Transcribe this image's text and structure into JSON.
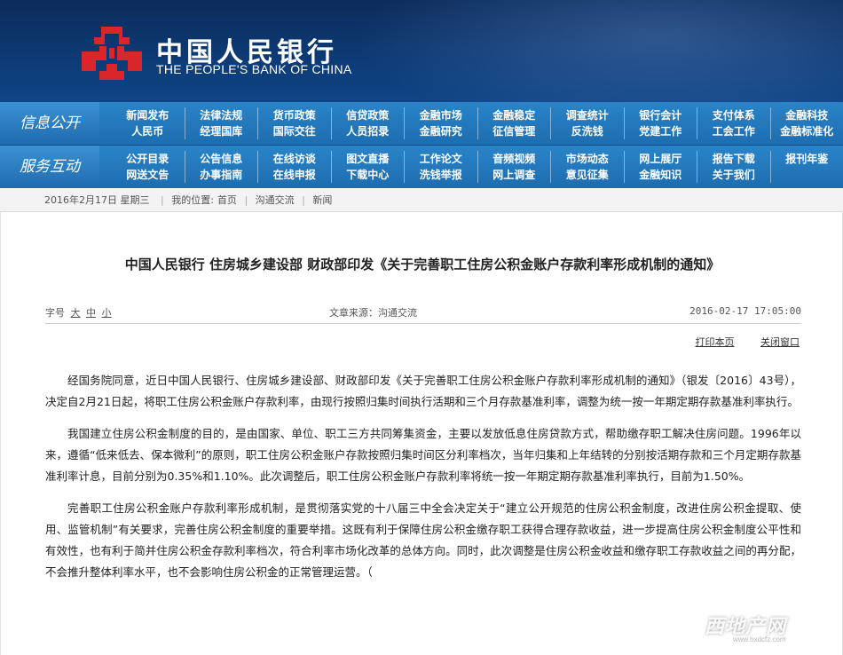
{
  "header": {
    "bank_name_cn": "中国人民银行",
    "bank_name_en": "THE PEOPLE'S BANK OF CHINA",
    "logo_icon": "pboc-logo-icon",
    "colors": {
      "header_bg": "#0d3a74",
      "nav_bg": "#1d6db0",
      "logo_red": "#d8262b"
    }
  },
  "nav": {
    "info_label": "信息公开",
    "info_items": [
      "新闻发布",
      "法律法规",
      "货币政策",
      "信贷政策",
      "金融市场",
      "金融稳定",
      "调查统计",
      "银行会计",
      "支付体系",
      "金融科技",
      "人民币",
      "经理国库",
      "国际交往",
      "人员招录",
      "金融研究",
      "征信管理",
      "反洗钱",
      "党建工作",
      "工会工作",
      "金融标准化"
    ],
    "service_label": "服务互动",
    "service_items": [
      "公开目录",
      "公告信息",
      "在线访谈",
      "图文直播",
      "工作论文",
      "音频视频",
      "市场动态",
      "网上展厅",
      "报告下载",
      "报刊年鉴",
      "网送文告",
      "办事指南",
      "在线申报",
      "下载中心",
      "洗钱举报",
      "网上调查",
      "意见征集",
      "金融知识",
      "关于我们",
      ""
    ]
  },
  "breadcrumb": {
    "date": "2016年2月17日 星期三",
    "location_label": "我的位置:",
    "home": "首页",
    "section": "沟通交流",
    "current": "新闻"
  },
  "article": {
    "title": "中国人民银行 住房城乡建设部 财政部印发《关于完善职工住房公积金账户存款利率形成机制的通知》",
    "fontsize_label": "字号",
    "fontsize_large": "大",
    "fontsize_medium": "中",
    "fontsize_small": "小",
    "source": "文章来源：沟通交流",
    "datetime": "2016-02-17 17:05:00",
    "print_label": "打印本页",
    "close_label": "关闭窗口",
    "paragraphs": [
      "经国务院同意，近日中国人民银行、住房城乡建设部、财政部印发《关于完善职工住房公积金账户存款利率形成机制的通知》（银发〔2016〕43号），决定自2月21日起，将职工住房公积金账户存款利率，由现行按照归集时间执行活期和三个月存款基准利率，调整为统一按一年期定期存款基准利率执行。",
      "我国建立住房公积金制度的目的，是由国家、单位、职工三方共同筹集资金，主要以发放低息住房贷款方式，帮助缴存职工解决住房问题。1996年以来，遵循“低来低去、保本微利”的原则，职工住房公积金账户存款按照归集时间区分利率档次，当年归集和上年结转的分别按活期存款和三个月定期存款基准利率计息，目前分别为0.35%和1.10%。此次调整后，职工住房公积金账户存款利率将统一按一年期定期存款基准利率执行，目前为1.50%。",
      "完善职工住房公积金账户存款利率形成机制，是贯彻落实党的十八届三中全会决定关于“建立公开规范的住房公积金制度，改进住房公积金提取、使用、监管机制”有关要求，完善住房公积金制度的重要举措。这既有利于保障住房公积金缴存职工获得合理存款收益，进一步提高住房公积金制度公平性和有效性，也有利于简并住房公积金存款利率档次，符合利率市场化改革的总体方向。同时，此次调整是住房公积金收益和缴存职工存款收益之间的再分配，不会推升整体利率水平，也不会影响住房公积金的正常管理运营。（"
    ]
  },
  "watermark": {
    "text": "西地产网",
    "url": "www.hxdcfz.com"
  }
}
